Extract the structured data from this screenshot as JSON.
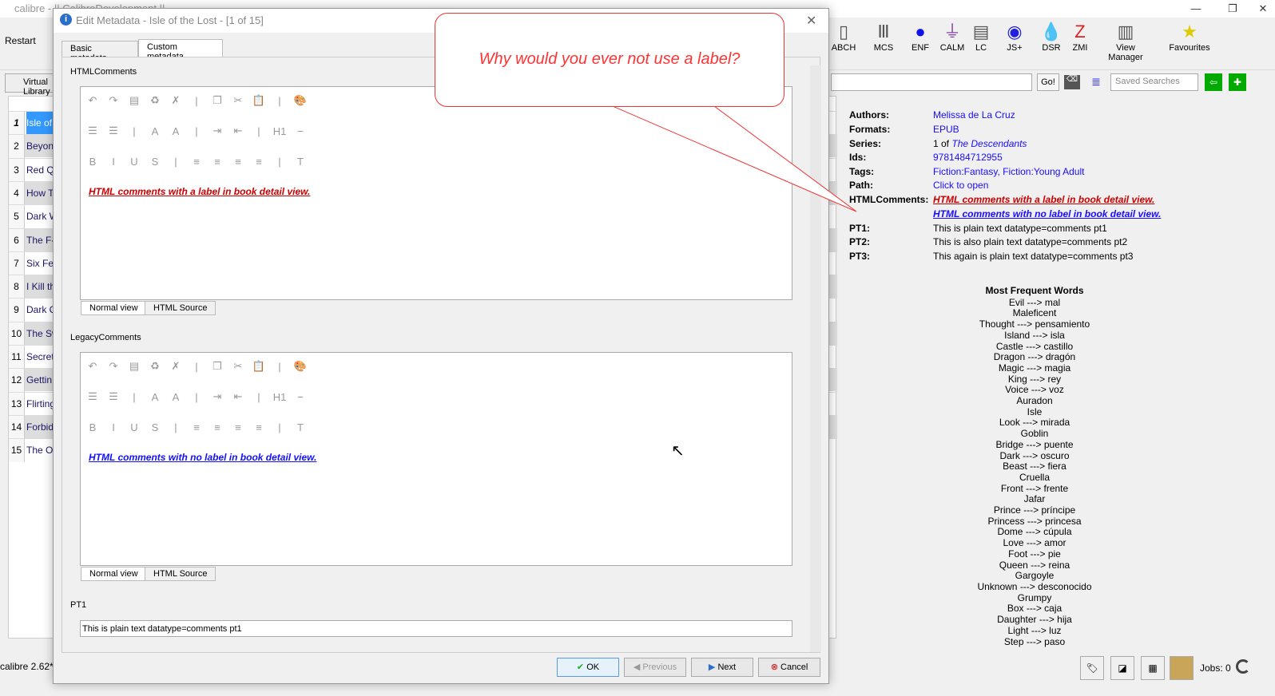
{
  "main": {
    "title": "calibre - || CalibreDevelopment ||",
    "restart": "Restart",
    "virtual_library": "Virtual Library",
    "status": "calibre 2.62*",
    "jobs": "Jobs: 0"
  },
  "toolbar": [
    {
      "label": "ABCH",
      "icon": "book-icon"
    },
    {
      "label": "MCS",
      "icon": "pillar-icon"
    },
    {
      "label": "ENF",
      "icon": "chart-circle-icon"
    },
    {
      "label": "CALM",
      "icon": "funnel-icon"
    },
    {
      "label": "LC",
      "icon": "catalog-icon"
    },
    {
      "label": "JS+",
      "icon": "eye-icon"
    },
    {
      "label": "DSR",
      "icon": "droplet-icon"
    },
    {
      "label": "ZMI",
      "icon": "z-icon"
    },
    {
      "label": "View Manager",
      "icon": "view-manager-icon"
    },
    {
      "label": "Favourites",
      "icon": "star-icon"
    }
  ],
  "search": {
    "go": "Go!",
    "saved_searches": "Saved Searches"
  },
  "books": [
    "Isle of",
    "Beyon",
    "Red Qu",
    "How T",
    "Dark W",
    "The F-",
    "Six Fee",
    "I Kill th",
    "Dark C",
    "The Sw",
    "Secrets",
    "Gettin",
    "Flirting",
    "Forbid",
    "The Ot"
  ],
  "details": {
    "authors_l": "Authors:",
    "authors": "Melissa de La Cruz",
    "formats_l": "Formats:",
    "formats": "EPUB",
    "series_l": "Series:",
    "series_pre": "1 of",
    "series": "The Descendants",
    "ids_l": "Ids:",
    "ids": "9781484712955",
    "tags_l": "Tags:",
    "tags": "Fiction:Fantasy, Fiction:Young Adult",
    "path_l": "Path:",
    "path": "Click to open",
    "html_l": "HTMLComments:",
    "html1": "HTML comments with a label in book detail view.",
    "html2": "HTML comments with no label in book detail view.",
    "pt1_l": "PT1:",
    "pt1": "This is plain text datatype=comments pt1",
    "pt2_l": "PT2:",
    "pt2": "This is also plain text datatype=comments pt2",
    "pt3_l": "PT3:",
    "pt3": "This again is plain text datatype=comments pt3",
    "words_title": "Most Frequent Words",
    "words": [
      "Evil ---> mal",
      "Maleficent",
      "Thought ---> pensamiento",
      "Island ---> isla",
      "Castle ---> castillo",
      "Dragon ---> dragón",
      "Magic ---> magia",
      "King ---> rey",
      "Voice ---> voz",
      "Auradon",
      "Isle",
      "Look ---> mirada",
      "Goblin",
      "Bridge ---> puente",
      "Dark ---> oscuro",
      "Beast ---> fiera",
      "Cruella",
      "Front ---> frente",
      "Jafar",
      "Prince ---> príncipe",
      "Princess ---> princesa",
      "Dome ---> cúpula",
      "Love ---> amor",
      "Foot ---> pie",
      "Queen ---> reina",
      "Gargoyle",
      "Unknown ---> desconocido",
      "Grumpy",
      "Box ---> caja",
      "Daughter ---> hija",
      "Light ---> luz",
      "Step ---> paso"
    ]
  },
  "dialog": {
    "title": "Edit Metadata - Isle of the Lost -  [1 of 15]",
    "tab_basic": "Basic metadata",
    "tab_custom": "Custom metadata",
    "html_label": "HTMLComments",
    "html_text": "HTML comments with a label in book detail view.",
    "legacy_label": "LegacyComments",
    "legacy_text": "HTML comments with no label in book detail view.",
    "normal_view": "Normal view",
    "html_source": "HTML Source",
    "pt1_label": "PT1",
    "pt1_value": "This is plain text datatype=comments pt1",
    "ok": "OK",
    "previous": "Previous",
    "next": "Next",
    "cancel": "Cancel"
  },
  "callout": "Why would you ever not use a label?"
}
